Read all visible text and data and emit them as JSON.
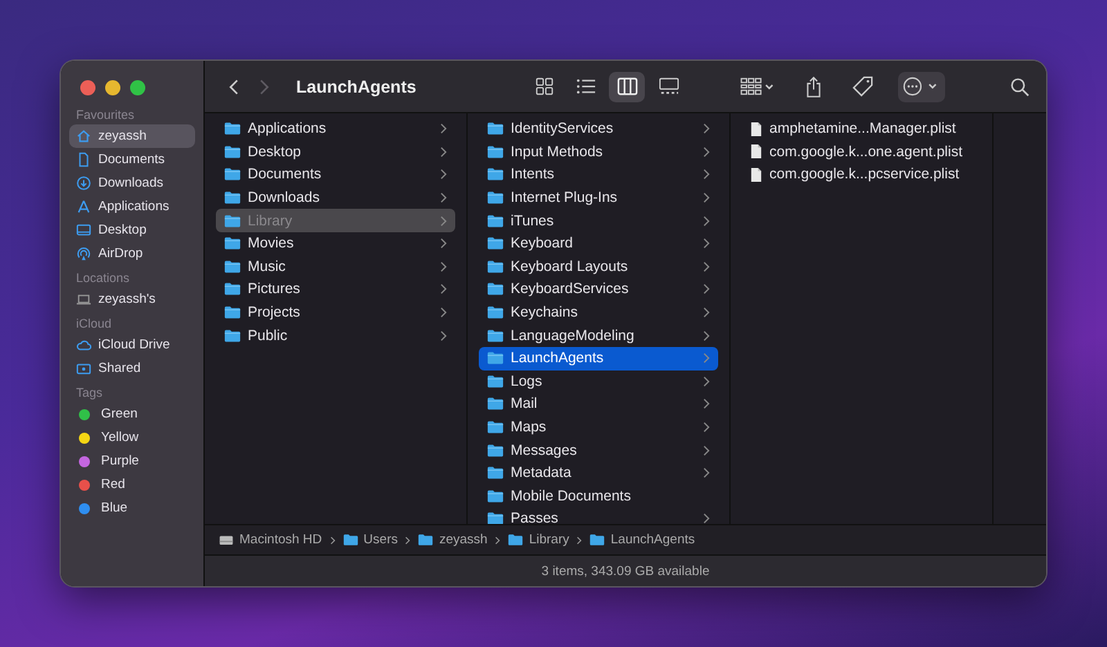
{
  "sidebar": {
    "sections": [
      {
        "heading": "Favourites",
        "items": [
          {
            "label": "zeyassh",
            "selected": true
          },
          {
            "label": "Documents",
            "selected": false
          },
          {
            "label": "Downloads",
            "selected": false
          },
          {
            "label": "Applications",
            "selected": false
          },
          {
            "label": "Desktop",
            "selected": false
          },
          {
            "label": "AirDrop",
            "selected": false
          }
        ]
      },
      {
        "heading": "Locations",
        "items": [
          {
            "label": "zeyassh's",
            "selected": false
          }
        ]
      },
      {
        "heading": "iCloud",
        "items": [
          {
            "label": "iCloud Drive",
            "selected": false
          },
          {
            "label": "Shared",
            "selected": false
          }
        ]
      },
      {
        "heading": "Tags",
        "items": [
          {
            "label": "Green",
            "selected": false,
            "color": "#30c048"
          },
          {
            "label": "Yellow",
            "selected": false,
            "color": "#f5d614"
          },
          {
            "label": "Purple",
            "selected": false,
            "color": "#c466e0"
          },
          {
            "label": "Red",
            "selected": false,
            "color": "#e8504a"
          },
          {
            "label": "Blue",
            "selected": false,
            "color": "#2f8ef0"
          }
        ]
      }
    ]
  },
  "toolbar": {
    "title": "LaunchAgents",
    "back": {
      "disabled": false
    },
    "forward": {
      "disabled": true
    },
    "view_modes": [
      {
        "selected": false
      },
      {
        "selected": false
      },
      {
        "selected": true
      },
      {
        "selected": false
      }
    ]
  },
  "columns": [
    {
      "active": false,
      "items": [
        {
          "label": "Applications",
          "selected": false,
          "expandable": true
        },
        {
          "label": "Desktop",
          "selected": false,
          "expandable": true
        },
        {
          "label": "Documents",
          "selected": false,
          "expandable": true
        },
        {
          "label": "Downloads",
          "selected": false,
          "expandable": true
        },
        {
          "label": "Library",
          "selected": true,
          "expandable": true
        },
        {
          "label": "Movies",
          "selected": false,
          "expandable": true
        },
        {
          "label": "Music",
          "selected": false,
          "expandable": true
        },
        {
          "label": "Pictures",
          "selected": false,
          "expandable": true
        },
        {
          "label": "Projects",
          "selected": false,
          "expandable": true
        },
        {
          "label": "Public",
          "selected": false,
          "expandable": true
        }
      ]
    },
    {
      "active": true,
      "items": [
        {
          "label": "IdentityServices",
          "selected": false,
          "expandable": true
        },
        {
          "label": "Input Methods",
          "selected": false,
          "expandable": true
        },
        {
          "label": "Intents",
          "selected": false,
          "expandable": true
        },
        {
          "label": "Internet Plug-Ins",
          "selected": false,
          "expandable": true
        },
        {
          "label": "iTunes",
          "selected": false,
          "expandable": true
        },
        {
          "label": "Keyboard",
          "selected": false,
          "expandable": true
        },
        {
          "label": "Keyboard Layouts",
          "selected": false,
          "expandable": true
        },
        {
          "label": "KeyboardServices",
          "selected": false,
          "expandable": true
        },
        {
          "label": "Keychains",
          "selected": false,
          "expandable": true
        },
        {
          "label": "LanguageModeling",
          "selected": false,
          "expandable": true
        },
        {
          "label": "LaunchAgents",
          "selected": true,
          "expandable": true
        },
        {
          "label": "Logs",
          "selected": false,
          "expandable": true
        },
        {
          "label": "Mail",
          "selected": false,
          "expandable": true
        },
        {
          "label": "Maps",
          "selected": false,
          "expandable": true
        },
        {
          "label": "Messages",
          "selected": false,
          "expandable": true
        },
        {
          "label": "Metadata",
          "selected": false,
          "expandable": true
        },
        {
          "label": "Mobile Documents",
          "selected": false,
          "expandable": false
        },
        {
          "label": "Passes",
          "selected": false,
          "expandable": true
        }
      ]
    }
  ],
  "files": [
    {
      "label": "amphetamine...Manager.plist"
    },
    {
      "label": "com.google.k...one.agent.plist"
    },
    {
      "label": "com.google.k...pcservice.plist"
    }
  ],
  "path_bar": [
    {
      "label": "Macintosh HD",
      "kind": "disk"
    },
    {
      "label": "Users",
      "kind": "folder"
    },
    {
      "label": "zeyassh",
      "kind": "folder"
    },
    {
      "label": "Library",
      "kind": "folder"
    },
    {
      "label": "LaunchAgents",
      "kind": "folder"
    }
  ],
  "status_bar": "3 items, 343.09 GB available"
}
